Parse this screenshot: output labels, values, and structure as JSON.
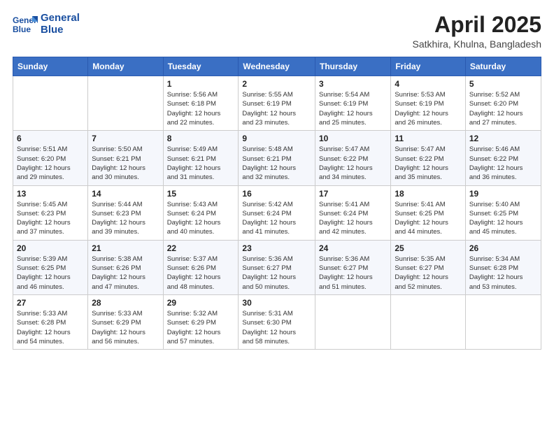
{
  "header": {
    "logo_line1": "General",
    "logo_line2": "Blue",
    "title": "April 2025",
    "subtitle": "Satkhira, Khulna, Bangladesh"
  },
  "columns": [
    "Sunday",
    "Monday",
    "Tuesday",
    "Wednesday",
    "Thursday",
    "Friday",
    "Saturday"
  ],
  "weeks": [
    {
      "days": [
        {
          "num": "",
          "info": ""
        },
        {
          "num": "",
          "info": ""
        },
        {
          "num": "1",
          "info": "Sunrise: 5:56 AM\nSunset: 6:18 PM\nDaylight: 12 hours\nand 22 minutes."
        },
        {
          "num": "2",
          "info": "Sunrise: 5:55 AM\nSunset: 6:19 PM\nDaylight: 12 hours\nand 23 minutes."
        },
        {
          "num": "3",
          "info": "Sunrise: 5:54 AM\nSunset: 6:19 PM\nDaylight: 12 hours\nand 25 minutes."
        },
        {
          "num": "4",
          "info": "Sunrise: 5:53 AM\nSunset: 6:19 PM\nDaylight: 12 hours\nand 26 minutes."
        },
        {
          "num": "5",
          "info": "Sunrise: 5:52 AM\nSunset: 6:20 PM\nDaylight: 12 hours\nand 27 minutes."
        }
      ]
    },
    {
      "days": [
        {
          "num": "6",
          "info": "Sunrise: 5:51 AM\nSunset: 6:20 PM\nDaylight: 12 hours\nand 29 minutes."
        },
        {
          "num": "7",
          "info": "Sunrise: 5:50 AM\nSunset: 6:21 PM\nDaylight: 12 hours\nand 30 minutes."
        },
        {
          "num": "8",
          "info": "Sunrise: 5:49 AM\nSunset: 6:21 PM\nDaylight: 12 hours\nand 31 minutes."
        },
        {
          "num": "9",
          "info": "Sunrise: 5:48 AM\nSunset: 6:21 PM\nDaylight: 12 hours\nand 32 minutes."
        },
        {
          "num": "10",
          "info": "Sunrise: 5:47 AM\nSunset: 6:22 PM\nDaylight: 12 hours\nand 34 minutes."
        },
        {
          "num": "11",
          "info": "Sunrise: 5:47 AM\nSunset: 6:22 PM\nDaylight: 12 hours\nand 35 minutes."
        },
        {
          "num": "12",
          "info": "Sunrise: 5:46 AM\nSunset: 6:22 PM\nDaylight: 12 hours\nand 36 minutes."
        }
      ]
    },
    {
      "days": [
        {
          "num": "13",
          "info": "Sunrise: 5:45 AM\nSunset: 6:23 PM\nDaylight: 12 hours\nand 37 minutes."
        },
        {
          "num": "14",
          "info": "Sunrise: 5:44 AM\nSunset: 6:23 PM\nDaylight: 12 hours\nand 39 minutes."
        },
        {
          "num": "15",
          "info": "Sunrise: 5:43 AM\nSunset: 6:24 PM\nDaylight: 12 hours\nand 40 minutes."
        },
        {
          "num": "16",
          "info": "Sunrise: 5:42 AM\nSunset: 6:24 PM\nDaylight: 12 hours\nand 41 minutes."
        },
        {
          "num": "17",
          "info": "Sunrise: 5:41 AM\nSunset: 6:24 PM\nDaylight: 12 hours\nand 42 minutes."
        },
        {
          "num": "18",
          "info": "Sunrise: 5:41 AM\nSunset: 6:25 PM\nDaylight: 12 hours\nand 44 minutes."
        },
        {
          "num": "19",
          "info": "Sunrise: 5:40 AM\nSunset: 6:25 PM\nDaylight: 12 hours\nand 45 minutes."
        }
      ]
    },
    {
      "days": [
        {
          "num": "20",
          "info": "Sunrise: 5:39 AM\nSunset: 6:25 PM\nDaylight: 12 hours\nand 46 minutes."
        },
        {
          "num": "21",
          "info": "Sunrise: 5:38 AM\nSunset: 6:26 PM\nDaylight: 12 hours\nand 47 minutes."
        },
        {
          "num": "22",
          "info": "Sunrise: 5:37 AM\nSunset: 6:26 PM\nDaylight: 12 hours\nand 48 minutes."
        },
        {
          "num": "23",
          "info": "Sunrise: 5:36 AM\nSunset: 6:27 PM\nDaylight: 12 hours\nand 50 minutes."
        },
        {
          "num": "24",
          "info": "Sunrise: 5:36 AM\nSunset: 6:27 PM\nDaylight: 12 hours\nand 51 minutes."
        },
        {
          "num": "25",
          "info": "Sunrise: 5:35 AM\nSunset: 6:27 PM\nDaylight: 12 hours\nand 52 minutes."
        },
        {
          "num": "26",
          "info": "Sunrise: 5:34 AM\nSunset: 6:28 PM\nDaylight: 12 hours\nand 53 minutes."
        }
      ]
    },
    {
      "days": [
        {
          "num": "27",
          "info": "Sunrise: 5:33 AM\nSunset: 6:28 PM\nDaylight: 12 hours\nand 54 minutes."
        },
        {
          "num": "28",
          "info": "Sunrise: 5:33 AM\nSunset: 6:29 PM\nDaylight: 12 hours\nand 56 minutes."
        },
        {
          "num": "29",
          "info": "Sunrise: 5:32 AM\nSunset: 6:29 PM\nDaylight: 12 hours\nand 57 minutes."
        },
        {
          "num": "30",
          "info": "Sunrise: 5:31 AM\nSunset: 6:30 PM\nDaylight: 12 hours\nand 58 minutes."
        },
        {
          "num": "",
          "info": ""
        },
        {
          "num": "",
          "info": ""
        },
        {
          "num": "",
          "info": ""
        }
      ]
    }
  ]
}
